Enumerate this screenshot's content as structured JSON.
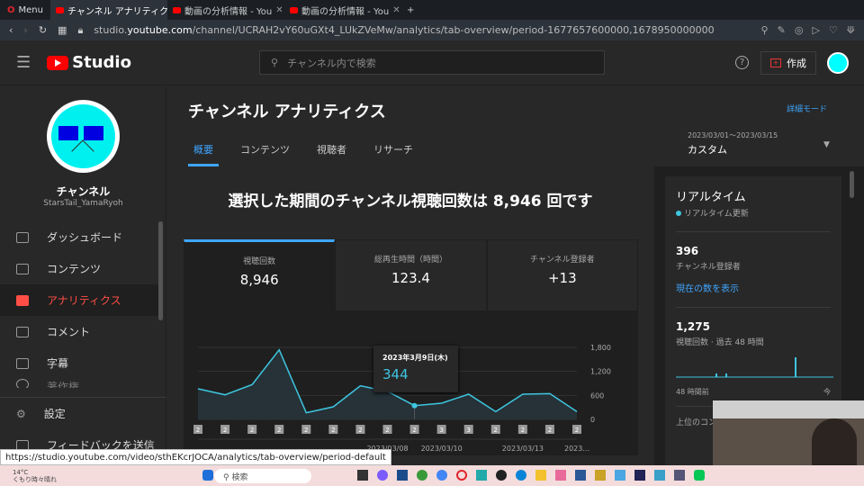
{
  "browser": {
    "menu_label": "Menu",
    "tabs": [
      {
        "title": "チャンネル アナリティクス",
        "active": true
      },
      {
        "title": "動画の分析情報 - You"
      },
      {
        "title": "動画の分析情報 - You"
      }
    ],
    "url_host": "studio.youtube.com",
    "url_prefix": "studio.",
    "url_domain": "youtube.com",
    "url_path": "/channel/UCRAH2vY60uGXt4_LUkZVeMw/analytics/tab-overview/period-1677657600000,1678950000000"
  },
  "header": {
    "logo": "Studio",
    "search_placeholder": "チャンネル内で検索",
    "help": "?",
    "create_label": "作成"
  },
  "sidebar": {
    "channel_name": "チャンネル",
    "channel_handle": "StarsTail_YamaRyoh",
    "items": [
      {
        "label": "ダッシュボード",
        "icon": "dashboard-icon"
      },
      {
        "label": "コンテンツ",
        "icon": "content-icon"
      },
      {
        "label": "アナリティクス",
        "icon": "analytics-icon",
        "active": true
      },
      {
        "label": "コメント",
        "icon": "comment-icon"
      },
      {
        "label": "字幕",
        "icon": "subtitles-icon"
      },
      {
        "label": "著作権",
        "icon": "copyright-icon"
      }
    ],
    "bottom": [
      {
        "label": "設定",
        "icon": "gear-icon"
      },
      {
        "label": "フィードバックを送信",
        "icon": "feedback-icon"
      }
    ]
  },
  "main": {
    "title": "チャンネル アナリティクス",
    "detail_mode": "詳細モード",
    "tabs": [
      "概要",
      "コンテンツ",
      "視聴者",
      "リサーチ"
    ],
    "date_range": "2023/03/01～2023/03/15",
    "period": "カスタム",
    "headline": "選択した期間のチャンネル視聴回数は 8,946 回です",
    "cards": [
      {
        "label": "視聴回数",
        "value": "8,946"
      },
      {
        "label": "総再生時間（時間）",
        "value": "123.4"
      },
      {
        "label": "チャンネル登録者",
        "value": "+13"
      }
    ],
    "tooltip": {
      "date": "2023年3月9日(木)",
      "value": "344"
    }
  },
  "chart_data": {
    "type": "area",
    "series": [
      {
        "name": "視聴回数",
        "values": [
          765,
          615,
          870,
          1740,
          165,
          315,
          840,
          700,
          344,
          405,
          630,
          195,
          630,
          645,
          195
        ]
      }
    ],
    "x": [
      "2023/03/01",
      "2023/03/02",
      "2023/03/03",
      "2023/03/04",
      "2023/03/05",
      "2023/03/06",
      "2023/03/07",
      "2023/03/08",
      "2023/03/09",
      "2023/03/10",
      "2023/03/11",
      "2023/03/12",
      "2023/03/13",
      "2023/03/14",
      "2023/03/15"
    ],
    "x_tick_labels": [
      {
        "i": 7,
        "label": "2023/03/08"
      },
      {
        "i": 9,
        "label": "2023/03/10"
      },
      {
        "i": 12,
        "label": "2023/03/13"
      },
      {
        "i": 14,
        "label": "2023..."
      }
    ],
    "yticks": [
      "0",
      "600",
      "1,200",
      "1,800"
    ],
    "ylim": [
      0,
      1800
    ],
    "badges": [
      "2",
      "2",
      "2",
      "2",
      "2",
      "2",
      "2",
      "2",
      "2",
      "3",
      "3",
      "2",
      "2",
      "2",
      "2"
    ],
    "grid": true
  },
  "realtime": {
    "title": "リアルタイム",
    "subtitle": "リアルタイム更新",
    "subs": "396",
    "subs_label": "チャンネル登録者",
    "show_link": "現在の数を表示",
    "views": "1,275",
    "views_label": "視聴回数 · 過去 48 時間",
    "left_label": "48 時間前",
    "right_label": "今",
    "top_content": "上位のコンテンツ"
  },
  "status_url": "https://studio.youtube.com/video/sthEKcrJOCA/analytics/tab-overview/period-default",
  "taskbar": {
    "temp": "14°C",
    "weather": "くもり時々晴れ",
    "search": "検索"
  },
  "colors": {
    "accent": "#3ea6ff",
    "active_nav": "#ff4e45",
    "line": "#3ec6e0"
  }
}
